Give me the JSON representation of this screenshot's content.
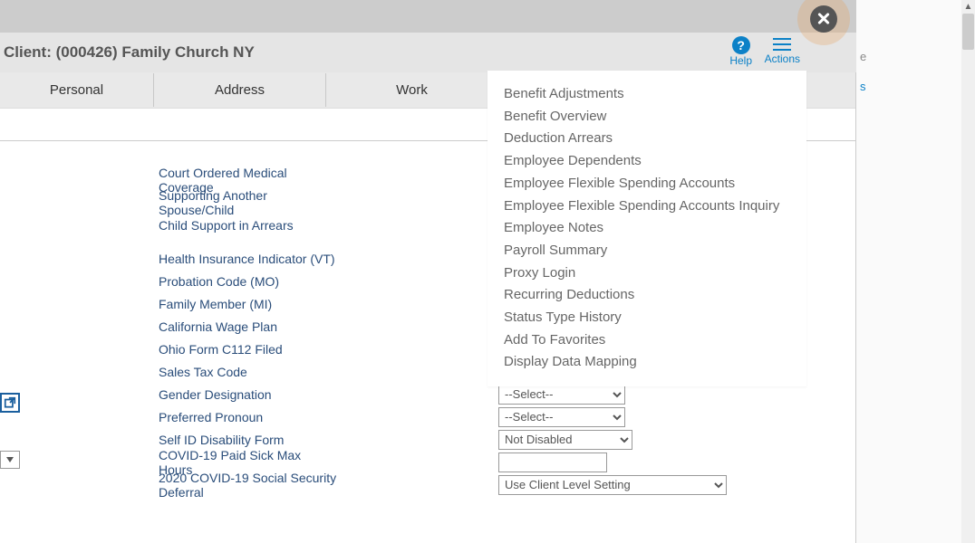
{
  "header": {
    "client_title": "Client: (000426) Family Church NY",
    "help_label": "Help",
    "actions_label": "Actions"
  },
  "tabs": [
    "Personal",
    "Address",
    "Work"
  ],
  "actions_menu": [
    "Benefit Adjustments",
    "Benefit Overview",
    "Deduction Arrears",
    "Employee Dependents",
    "Employee Flexible Spending Accounts",
    "Employee Flexible Spending Accounts Inquiry",
    "Employee Notes",
    "Payroll Summary",
    "Proxy Login",
    "Recurring Deductions",
    "Status Type History",
    "Add To Favorites",
    "Display Data Mapping"
  ],
  "form": {
    "labels": {
      "court_ordered": "Court Ordered Medical Coverage",
      "supporting": "Supporting Another Spouse/Child",
      "child_support": "Child Support in Arrears",
      "health_vt": "Health Insurance Indicator (VT)",
      "probation_mo": "Probation Code (MO)",
      "family_mi": "Family Member (MI)",
      "ca_wage": "California Wage Plan",
      "ohio_c112": "Ohio Form C112 Filed",
      "sales_tax": "Sales Tax Code",
      "gender": "Gender Designation",
      "pronoun": "Preferred Pronoun",
      "self_id": "Self ID Disability Form",
      "covid_sick": "COVID-19 Paid Sick Max Hours",
      "covid_ss": "2020 COVID-19 Social Security Deferral"
    },
    "values": {
      "sales_tax": "",
      "gender": "--Select--",
      "pronoun": "--Select--",
      "self_id": "Not Disabled",
      "covid_sick": "",
      "covid_ss": "Use Client Level Setting"
    }
  },
  "right_stub_s": "s",
  "right_stub_e": "e"
}
